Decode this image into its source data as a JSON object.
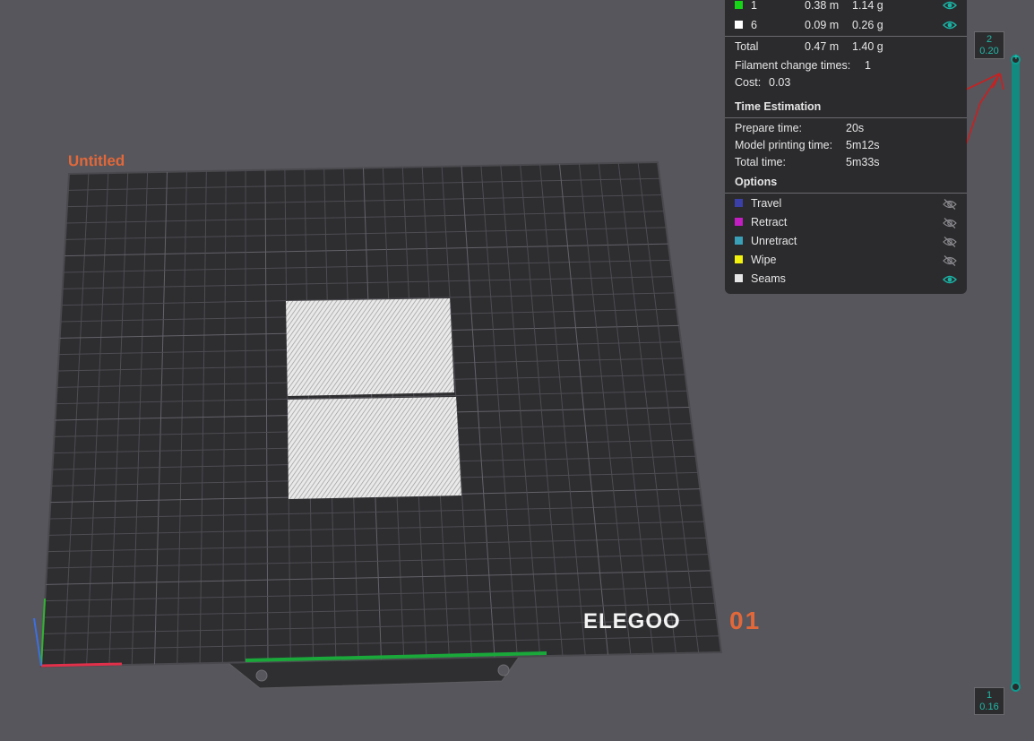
{
  "plate": {
    "name": "Untitled",
    "number": "01",
    "brand_logo": "ELEGOO"
  },
  "filaments": [
    {
      "id": "1",
      "length": "0.38 m",
      "weight": "1.14 g",
      "color": "#16d416",
      "visibility_icon": "eye-icon"
    },
    {
      "id": "6",
      "length": "0.09 m",
      "weight": "0.26 g",
      "color": "#ffffff",
      "visibility_icon": "eye-icon"
    }
  ],
  "totals": {
    "label": "Total",
    "length": "0.47 m",
    "weight": "1.40 g",
    "filament_change_label": "Filament change times:",
    "filament_change_value": "1",
    "cost_label": "Cost:",
    "cost_value": "0.03"
  },
  "time_estimation": {
    "title": "Time Estimation",
    "rows": [
      {
        "label": "Prepare time:",
        "value": "20s"
      },
      {
        "label": "Model printing time:",
        "value": "5m12s"
      },
      {
        "label": "Total time:",
        "value": "5m33s"
      }
    ]
  },
  "options": {
    "title": "Options",
    "items": [
      {
        "label": "Travel",
        "color": "#3b3fa8",
        "visible": false
      },
      {
        "label": "Retract",
        "color": "#c21ec2",
        "visible": false
      },
      {
        "label": "Unretract",
        "color": "#3aa0b8",
        "visible": false
      },
      {
        "label": "Wipe",
        "color": "#f2f20e",
        "visible": false
      },
      {
        "label": "Seams",
        "color": "#e6e6e6",
        "visible": true
      }
    ]
  },
  "layer_slider": {
    "top_layer": "2",
    "top_height": "0.20",
    "bottom_layer": "1",
    "bottom_height": "0.16"
  },
  "colors": {
    "accent": "#118a7f",
    "plate_label": "#e2683a",
    "annotation": "#cc1f1f"
  }
}
